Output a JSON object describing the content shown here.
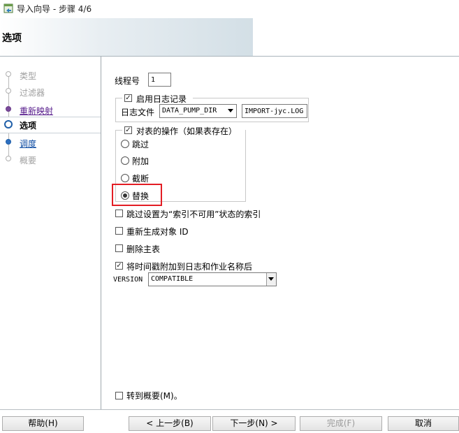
{
  "window": {
    "title": "导入向导 - 步骤 4/6"
  },
  "header": {
    "title": "选项"
  },
  "steps": [
    {
      "label": "类型",
      "state": "done"
    },
    {
      "label": "过滤器",
      "state": "done"
    },
    {
      "label": "重新映射",
      "state": "link"
    },
    {
      "label": "选项",
      "state": "current"
    },
    {
      "label": "调度",
      "state": "next"
    },
    {
      "label": "概要",
      "state": "future"
    }
  ],
  "options": {
    "thread_label": "线程号",
    "thread_value": "1",
    "logging_label": "启用日志记录",
    "logging_checked": true,
    "logfile_label": "日志文件",
    "logfile_dir": "DATA_PUMP_DIR",
    "logfile_name": "IMPORT-jyc.LOG",
    "table_action_label": "对表的操作（如果表存在）",
    "table_action_checked": true,
    "radios": [
      {
        "label": "跳过",
        "selected": false
      },
      {
        "label": "附加",
        "selected": false
      },
      {
        "label": "截断",
        "selected": false
      },
      {
        "label": "替换",
        "selected": true
      }
    ],
    "skip_unusable_label": "跳过设置为“索引不可用”状态的索引",
    "skip_unusable_checked": false,
    "regen_oid_label": "重新生成对象 ID",
    "regen_oid_checked": false,
    "delete_master_label": "删除主表",
    "delete_master_checked": false,
    "append_timestamp_label": "将时间戳附加到日志和作业名称后",
    "append_timestamp_checked": true,
    "version_label": "VERSION",
    "version_value": "COMPATIBLE",
    "goto_summary_label": "转到概要(M)。",
    "goto_summary_checked": false
  },
  "buttons": {
    "help": "帮助(H)",
    "back": "< 上一步(B)",
    "next": "下一步(N) >",
    "finish": "完成(F)",
    "cancel": "取消"
  },
  "colors": {
    "highlight_border": "#e31d24",
    "link": "#551a8b",
    "active_step": "#0b4aa2"
  },
  "icons": {
    "window": "import-wizard-icon"
  }
}
